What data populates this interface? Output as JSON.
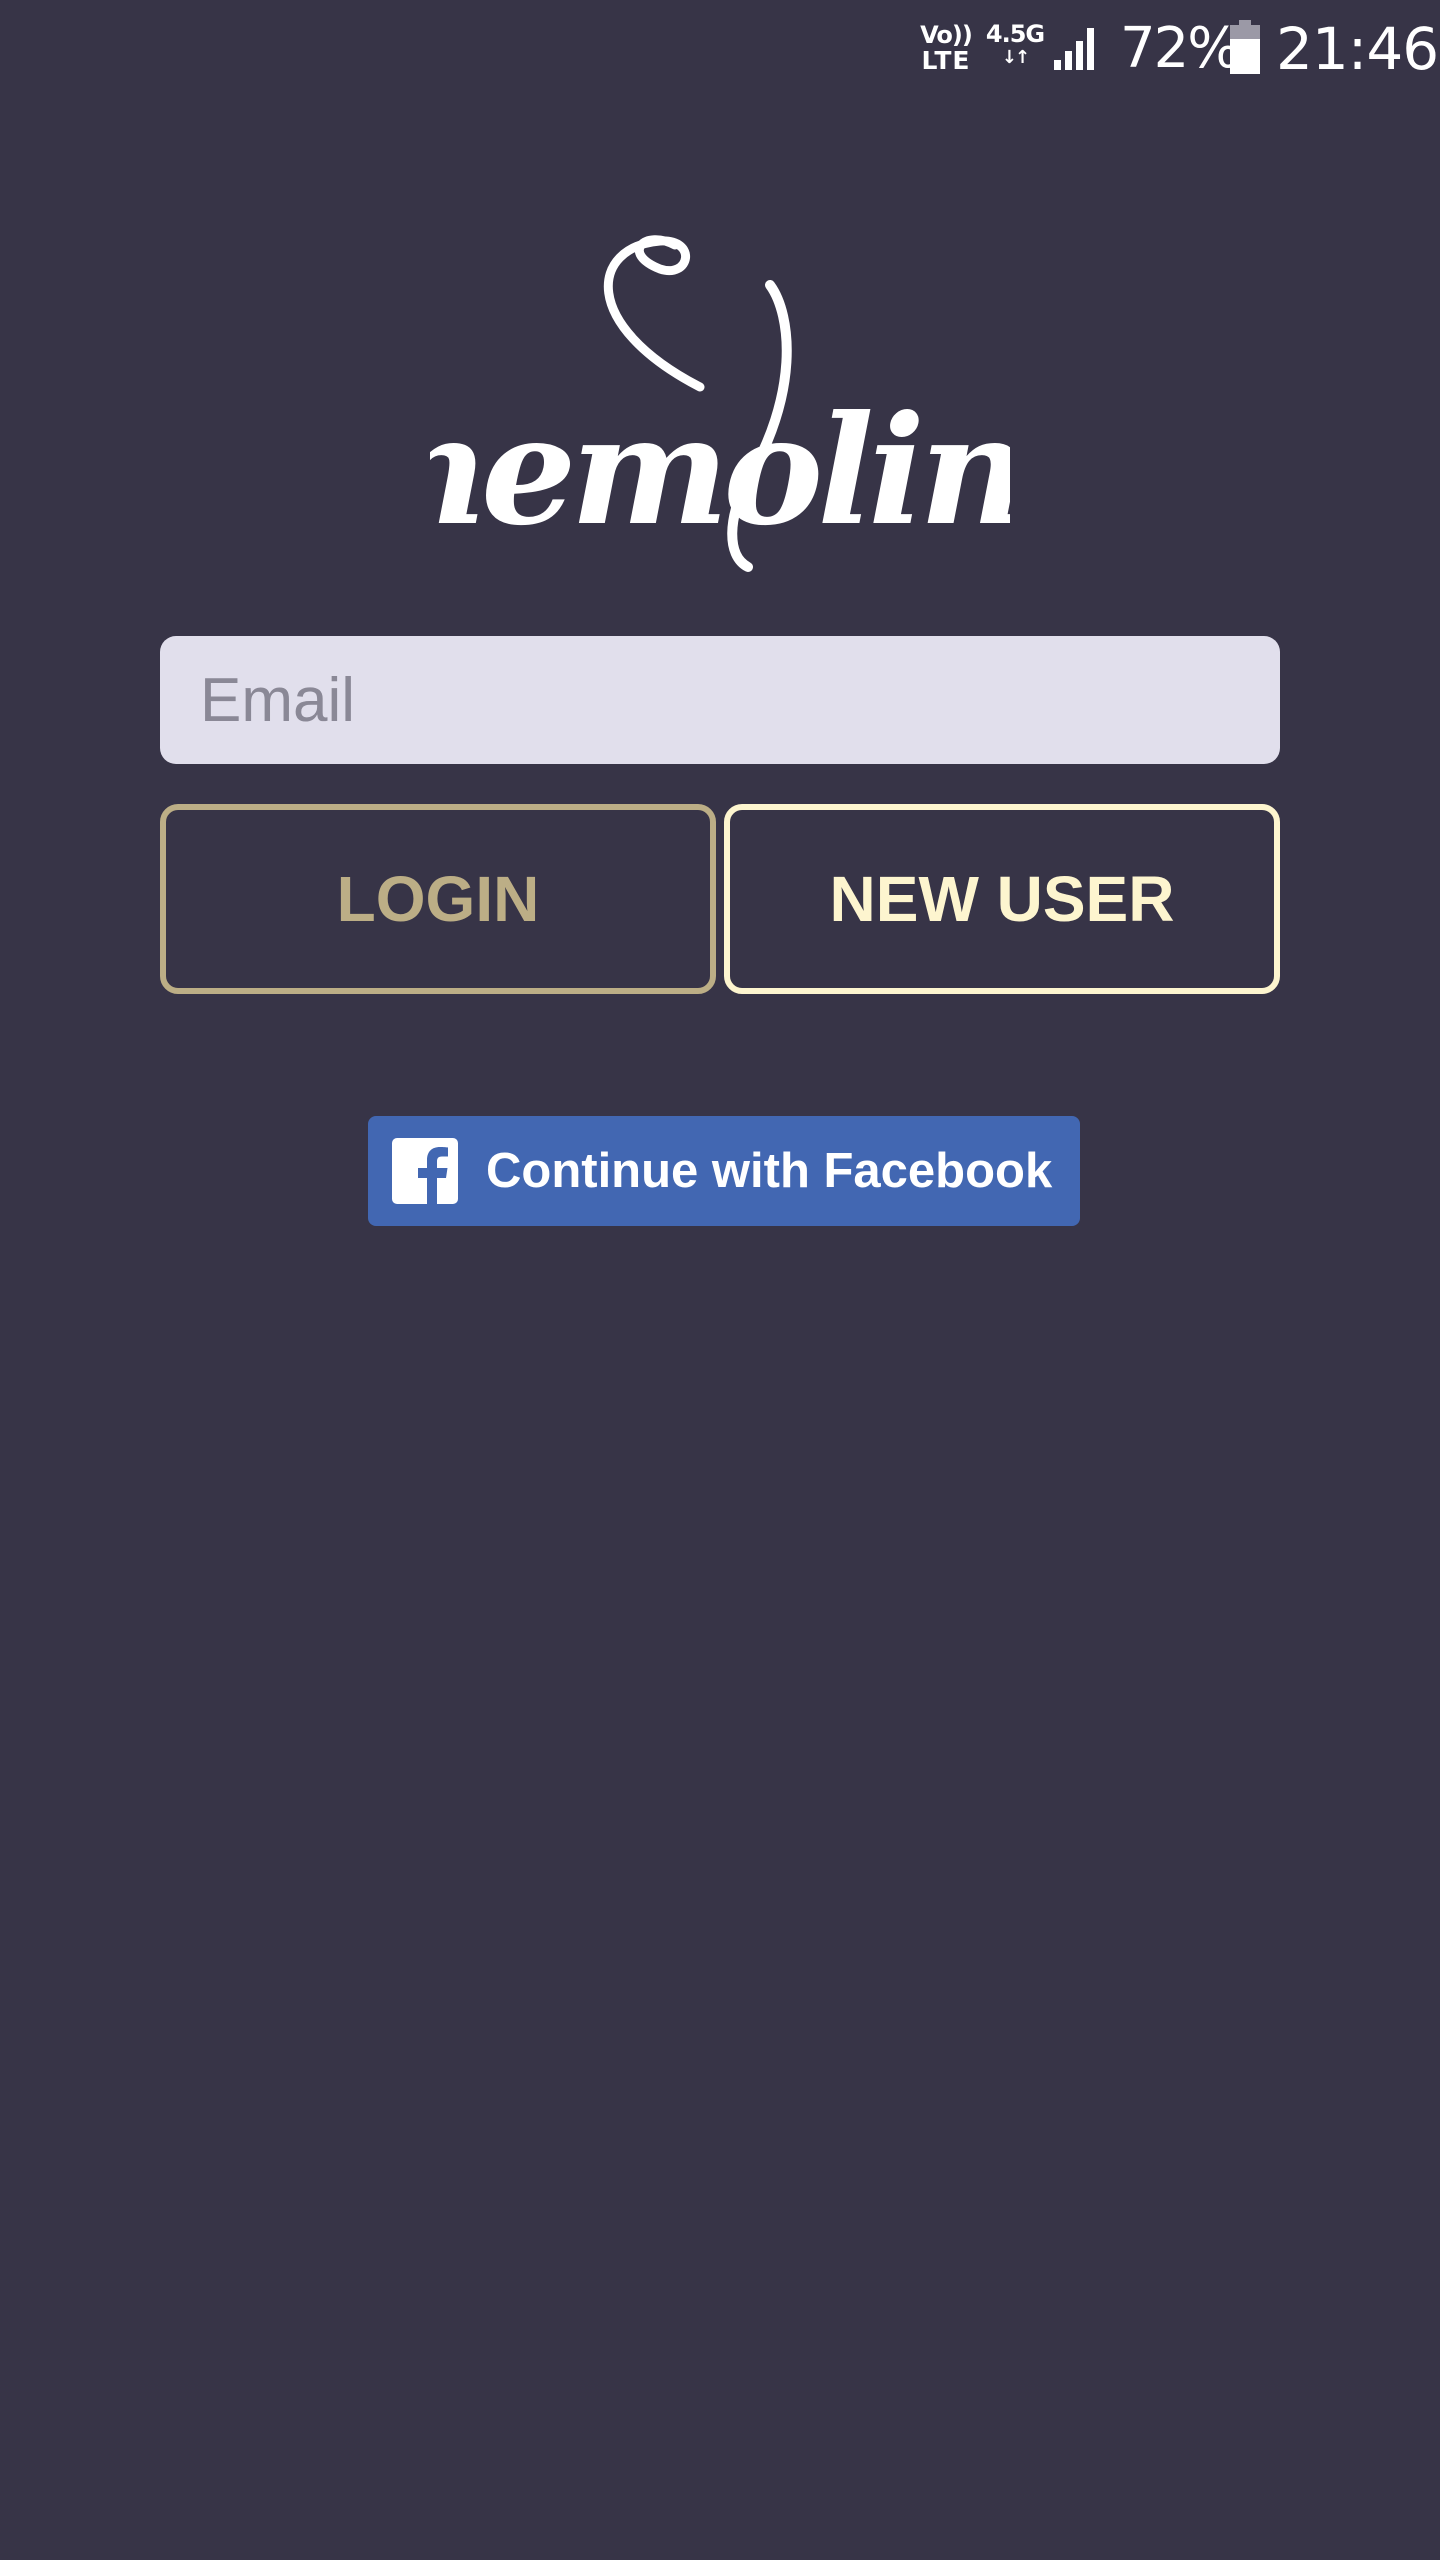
{
  "status_bar": {
    "volte_top": "Vo))",
    "volte_bottom": "LTE",
    "network_type": "4.5G",
    "network_arrows": "↓↑",
    "signal_icon": "signal-bars-icon",
    "battery_percent": "72%",
    "battery_icon": "battery-icon",
    "time": "21:46"
  },
  "logo": {
    "text": "memoline",
    "color": "#ffffff"
  },
  "email": {
    "placeholder": "Email",
    "value": ""
  },
  "buttons": {
    "login_label": "LOGIN",
    "new_user_label": "NEW USER"
  },
  "facebook": {
    "label": "Continue with Facebook",
    "icon": "facebook-icon"
  },
  "colors": {
    "background": "#373447",
    "login_accent": "#bcae86",
    "new_user_accent": "#fdf5cf",
    "email_background": "#e1dfec",
    "facebook_blue": "#4267b2"
  }
}
